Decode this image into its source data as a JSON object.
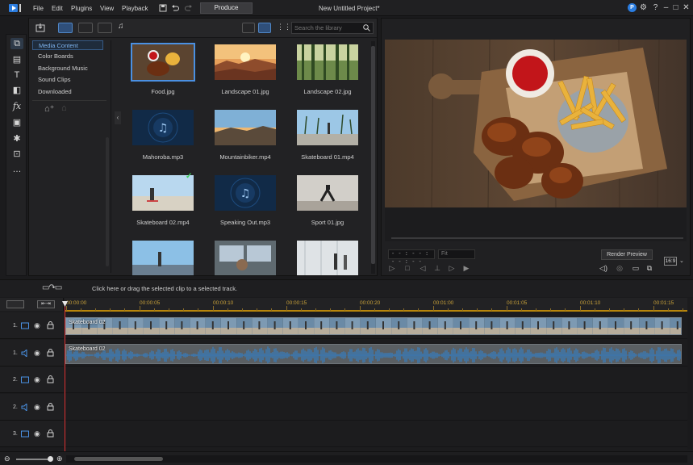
{
  "app": {
    "title": "New Untitled Project*",
    "produce_label": "Produce",
    "brand_badge": "P"
  },
  "menu": [
    "File",
    "Edit",
    "Plugins",
    "View",
    "Playback"
  ],
  "library": {
    "search_placeholder": "Search the library",
    "tree": [
      "Media Content",
      "Color Boards",
      "Background Music",
      "Sound Clips",
      "Downloaded"
    ],
    "items": [
      {
        "name": "Food.jpg",
        "kind": "photo-food",
        "selected": true
      },
      {
        "name": "Landscape 01.jpg",
        "kind": "photo-canyon"
      },
      {
        "name": "Landscape 02.jpg",
        "kind": "photo-forest"
      },
      {
        "name": "Mahoroba.mp3",
        "kind": "audio"
      },
      {
        "name": "Mountainbiker.mp4",
        "kind": "photo-sunset"
      },
      {
        "name": "Skateboard 01.mp4",
        "kind": "photo-palms"
      },
      {
        "name": "Skateboard 02.mp4",
        "kind": "photo-skate",
        "used": true
      },
      {
        "name": "Speaking Out.mp3",
        "kind": "audio"
      },
      {
        "name": "Sport 01.jpg",
        "kind": "photo-gym"
      },
      {
        "name": "",
        "kind": "photo-pier"
      },
      {
        "name": "",
        "kind": "photo-train"
      },
      {
        "name": "",
        "kind": "photo-airport"
      }
    ]
  },
  "preview": {
    "timecode": "- - : - - : - - : - -",
    "fit_label": "Fit",
    "render_preview_label": "Render Preview",
    "aspect_label": "16:9"
  },
  "timeline": {
    "hint": "Click here or drag the selected clip to a selected track.",
    "ruler": [
      "00:00:00",
      "00:00:05",
      "00:00:10",
      "00:00:15",
      "00:00:20",
      "00:01:00",
      "00:01:05",
      "00:01:10",
      "00:01:15"
    ],
    "tracks": [
      {
        "num": "1.",
        "type": "video"
      },
      {
        "num": "1.",
        "type": "audio"
      },
      {
        "num": "2.",
        "type": "video"
      },
      {
        "num": "2.",
        "type": "audio"
      },
      {
        "num": "3.",
        "type": "video"
      }
    ],
    "video_clip_label": "Skateboard 02",
    "audio_clip_label": "Skateboard 02"
  },
  "colors": {
    "accent": "#4a90e2",
    "playhead": "#dd3333",
    "ruler_text": "#c9a23a",
    "used_check": "#3ccf5a"
  }
}
